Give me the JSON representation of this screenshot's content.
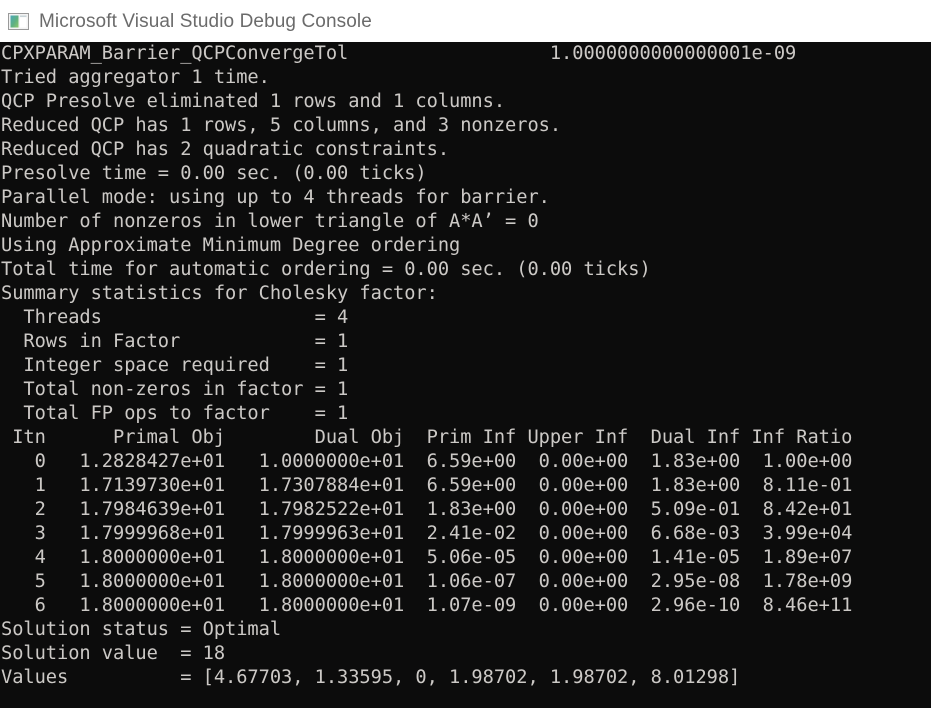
{
  "window": {
    "title": "Microsoft Visual Studio Debug Console",
    "icon": "visual-studio-console-icon",
    "titlebar_bg": "#ffffff",
    "titlebar_fg": "#6b6b6b",
    "console_bg": "#0c0c0c",
    "console_fg": "#ccc9c6"
  },
  "console": {
    "lines": [
      "CPXPARAM_Barrier_QCPConvergeTol                  1.0000000000000001e-09",
      "Tried aggregator 1 time.",
      "QCP Presolve eliminated 1 rows and 1 columns.",
      "Reduced QCP has 1 rows, 5 columns, and 3 nonzeros.",
      "Reduced QCP has 2 quadratic constraints.",
      "Presolve time = 0.00 sec. (0.00 ticks)",
      "Parallel mode: using up to 4 threads for barrier.",
      "Number of nonzeros in lower triangle of A*A’ = 0",
      "Using Approximate Minimum Degree ordering",
      "Total time for automatic ordering = 0.00 sec. (0.00 ticks)",
      "Summary statistics for Cholesky factor:",
      "  Threads                   = 4",
      "  Rows in Factor            = 1",
      "  Integer space required    = 1",
      "  Total non-zeros in factor = 1",
      "  Total FP ops to factor    = 1",
      " Itn      Primal Obj        Dual Obj  Prim Inf Upper Inf  Dual Inf Inf Ratio",
      "   0   1.2828427e+01   1.0000000e+01  6.59e+00  0.00e+00  1.83e+00  1.00e+00",
      "   1   1.7139730e+01   1.7307884e+01  6.59e+00  0.00e+00  1.83e+00  8.11e-01",
      "   2   1.7984639e+01   1.7982522e+01  1.83e+00  0.00e+00  5.09e-01  8.42e+01",
      "   3   1.7999968e+01   1.7999963e+01  2.41e-02  0.00e+00  6.68e-03  3.99e+04",
      "   4   1.8000000e+01   1.8000000e+01  5.06e-05  0.00e+00  1.41e-05  1.89e+07",
      "   5   1.8000000e+01   1.8000000e+01  1.06e-07  0.00e+00  2.95e-08  1.78e+09",
      "   6   1.8000000e+01   1.8000000e+01  1.07e-09  0.00e+00  2.96e-10  8.46e+11",
      "Solution status = Optimal",
      "Solution value  = 18",
      "Values          = [4.67703, 1.33595, 0, 1.98702, 1.98702, 8.01298]"
    ],
    "solver_log": {
      "parameter_name": "CPXPARAM_Barrier_QCPConvergeTol",
      "parameter_value": "1.0000000000000001e-09",
      "aggregator": "Tried aggregator 1 time.",
      "presolve_eliminated": "QCP Presolve eliminated 1 rows and 1 columns.",
      "reduced_qcp": "Reduced QCP has 1 rows, 5 columns, and 3 nonzeros.",
      "reduced_quadratic": "Reduced QCP has 2 quadratic constraints.",
      "presolve_time": "Presolve time = 0.00 sec. (0.00 ticks)",
      "parallel_mode": "Parallel mode: using up to 4 threads for barrier.",
      "nonzeros_lower_triangle": "Number of nonzeros in lower triangle of A*A’ = 0",
      "ordering": "Using Approximate Minimum Degree ordering",
      "ordering_time": "Total time for automatic ordering = 0.00 sec. (0.00 ticks)",
      "cholesky_header": "Summary statistics for Cholesky factor:",
      "cholesky_stats": [
        {
          "label": "Threads",
          "value": "4"
        },
        {
          "label": "Rows in Factor",
          "value": "1"
        },
        {
          "label": "Integer space required",
          "value": "1"
        },
        {
          "label": "Total non-zeros in factor",
          "value": "1"
        },
        {
          "label": "Total FP ops to factor",
          "value": "1"
        }
      ],
      "iteration_table": {
        "columns": [
          "Itn",
          "Primal Obj",
          "Dual Obj",
          "Prim Inf",
          "Upper Inf",
          "Dual Inf",
          "Inf Ratio"
        ],
        "rows": [
          [
            "0",
            "1.2828427e+01",
            "1.0000000e+01",
            "6.59e+00",
            "0.00e+00",
            "1.83e+00",
            "1.00e+00"
          ],
          [
            "1",
            "1.7139730e+01",
            "1.7307884e+01",
            "6.59e+00",
            "0.00e+00",
            "1.83e+00",
            "8.11e-01"
          ],
          [
            "2",
            "1.7984639e+01",
            "1.7982522e+01",
            "1.83e+00",
            "0.00e+00",
            "5.09e-01",
            "8.42e+01"
          ],
          [
            "3",
            "1.7999968e+01",
            "1.7999963e+01",
            "2.41e-02",
            "0.00e+00",
            "6.68e-03",
            "3.99e+04"
          ],
          [
            "4",
            "1.8000000e+01",
            "1.8000000e+01",
            "5.06e-05",
            "0.00e+00",
            "1.41e-05",
            "1.89e+07"
          ],
          [
            "5",
            "1.8000000e+01",
            "1.8000000e+01",
            "1.06e-07",
            "0.00e+00",
            "2.95e-08",
            "1.78e+09"
          ],
          [
            "6",
            "1.8000000e+01",
            "1.8000000e+01",
            "1.07e-09",
            "0.00e+00",
            "2.96e-10",
            "8.46e+11"
          ]
        ]
      },
      "solution_status": "Solution status = Optimal",
      "solution_value": "Solution value  = 18",
      "values": "Values          = [4.67703, 1.33595, 0, 1.98702, 1.98702, 8.01298]"
    }
  }
}
